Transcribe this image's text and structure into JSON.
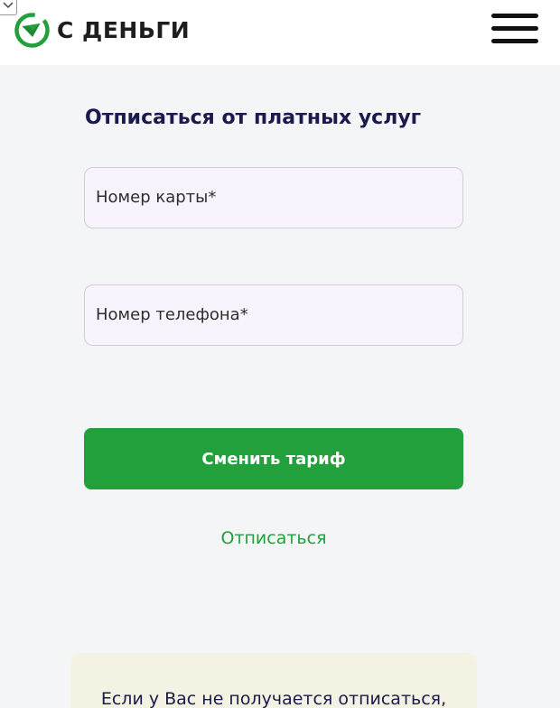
{
  "header": {
    "brand_name": "С ДЕНЬГИ",
    "logo_icon": "checkmark-circle-logo",
    "menu_icon": "hamburger-menu-icon"
  },
  "form": {
    "title": "Отписаться от платных услуг",
    "card_field_label": "Номер карты*",
    "phone_field_label": "Номер телефона*",
    "change_tariff_button": "Сменить тариф",
    "unsubscribe_link": "Отписаться"
  },
  "info": {
    "text": "Если у Вас не получается отписаться,"
  },
  "colors": {
    "accent_green": "#22a03c",
    "title_navy": "#1a1a4e",
    "field_background": "#f8f3fc",
    "info_background": "#f4f3e3",
    "page_background": "#f4f5f7"
  }
}
